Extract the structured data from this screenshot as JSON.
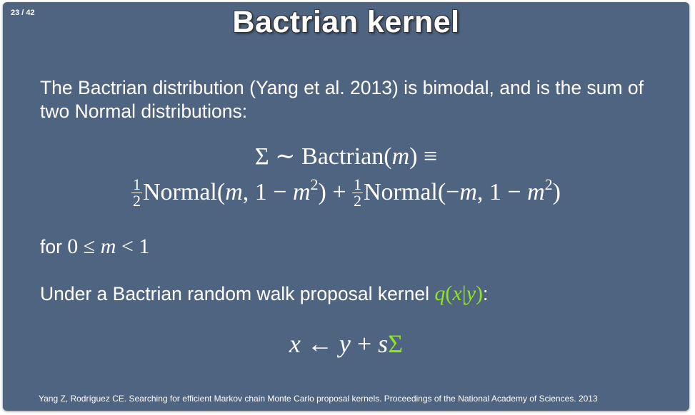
{
  "slide": {
    "counter": "23 / 42",
    "title": "Bactrian kernel",
    "intro": "The Bactrian distribution (Yang et al. 2013) is bimodal, and is the sum of two Normal distributions:",
    "equation_line1": {
      "sigma": "Σ",
      "sim": "∼",
      "dist": "Bactrian(",
      "m": "m",
      "close": ")",
      "equiv": "≡"
    },
    "equation_line2": {
      "half_num": "1",
      "half_den": "2",
      "normal1": "Normal(",
      "m": "m",
      "part1": ", 1 − ",
      "m2": "m",
      "exp": "2",
      "close1": ") + ",
      "normal2": "Normal(−",
      "close2": ")"
    },
    "condition": {
      "prefix": "for ",
      "expr_a": "0 ≤ ",
      "m": "m",
      "expr_b": " < 1"
    },
    "kernel_text": {
      "prefix": "Under a Bactrian random walk proposal kernel ",
      "q": "q",
      "paren_open": "(",
      "x": "x",
      "bar": "|",
      "y": "y",
      "paren_close": ")",
      "suffix": ":"
    },
    "update_equation": {
      "x": "x",
      "arrow": " ← ",
      "y": "y",
      "plus": " + ",
      "s": "s",
      "sigma": "Σ"
    },
    "citation": "Yang Z, Rodríguez CE. Searching for efficient Markov chain Monte Carlo proposal kernels. Proceedings of the National Academy of Sciences. 2013"
  },
  "colors": {
    "background": "#4f6481",
    "text": "#ffffff",
    "highlight": "#8ee51a"
  }
}
